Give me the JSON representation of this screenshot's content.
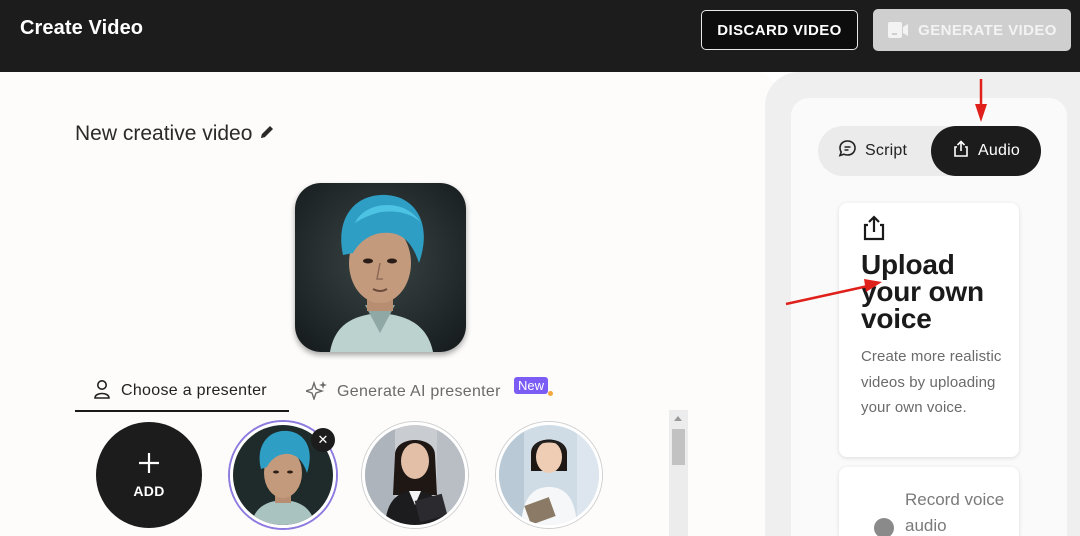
{
  "header": {
    "title": "Create Video",
    "discard_label": "DISCARD VIDEO",
    "generate_label": "GENERATE VIDEO"
  },
  "editor": {
    "video_title": "New creative video",
    "tabs": {
      "choose_presenter": "Choose a presenter",
      "generate_ai": "Generate AI presenter",
      "new_badge": "New"
    },
    "add_label": "ADD",
    "remove_symbol": "✕"
  },
  "right_panel": {
    "tabs": {
      "script": "Script",
      "audio": "Audio"
    },
    "active_tab": "Audio",
    "upload": {
      "title": "Upload your own voice",
      "description": "Create more realistic videos by uploading your own voice."
    },
    "record": {
      "label": "Record voice audio"
    }
  },
  "colors": {
    "header_bg": "#1c1c1c",
    "accent_purple": "#7b5cf5",
    "annotation_red": "#e0201a"
  },
  "icons": [
    "edit-pencil-icon",
    "person-icon",
    "sparkle-icon",
    "plus-icon",
    "close-icon",
    "chat-bubble-icon",
    "upload-icon",
    "video-camera-icon"
  ]
}
